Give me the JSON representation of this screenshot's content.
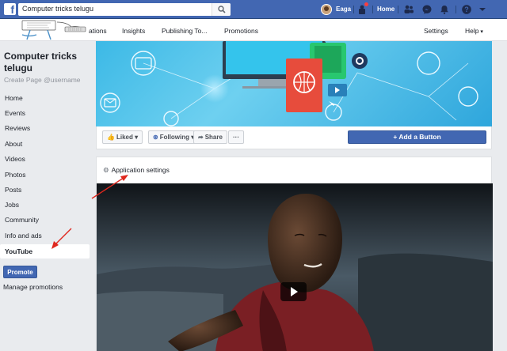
{
  "topbar": {
    "search_value": "Computer tricks telugu",
    "user_name": "Eaga",
    "home_label": "Home"
  },
  "subnav": {
    "items": [
      "ations",
      "Insights",
      "Publishing To...",
      "Promotions"
    ],
    "settings_label": "Settings",
    "help_label": "Help"
  },
  "sidebar": {
    "page_name": "Computer tricks telugu",
    "page_username": "Create Page @username",
    "items": [
      "Home",
      "Events",
      "Reviews",
      "About",
      "Videos",
      "Photos",
      "Posts",
      "Jobs",
      "Community",
      "Info and ads",
      "YouTube"
    ],
    "active_item": "YouTube",
    "promote_label": "Promote",
    "manage_promotions_label": "Manage promotions"
  },
  "actions": {
    "liked_label": "Liked",
    "following_label": "Following",
    "share_label": "Share",
    "more_label": "···",
    "add_button_label": "+ Add a Button"
  },
  "app_panel": {
    "settings_label": "Application settings"
  },
  "colors": {
    "brand_blue": "#4267b2",
    "background": "#e9ebee",
    "annotation_red": "#e0281e"
  }
}
